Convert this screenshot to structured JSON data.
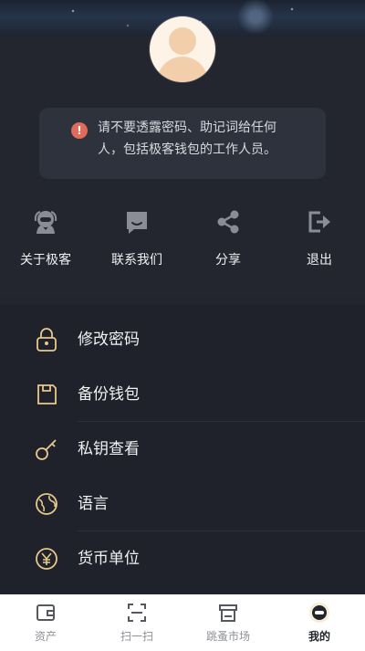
{
  "notice": {
    "text": "请不要透露密码、助记词给任何人，包括极客钱包的工作人员。",
    "icon": "exclamation-circle-icon",
    "icon_color": "#e06b5a"
  },
  "actions": [
    {
      "label": "关于极客",
      "icon": "geek-mascot-icon"
    },
    {
      "label": "联系我们",
      "icon": "chat-bubble-icon"
    },
    {
      "label": "分享",
      "icon": "share-icon"
    },
    {
      "label": "退出",
      "icon": "exit-icon"
    }
  ],
  "menu": [
    {
      "label": "修改密码",
      "icon": "lock-icon"
    },
    {
      "label": "备份钱包",
      "icon": "backup-icon"
    },
    {
      "label": "私钥查看",
      "icon": "key-icon"
    },
    {
      "label": "语言",
      "icon": "globe-icon"
    },
    {
      "label": "货币单位",
      "icon": "currency-yen-icon"
    }
  ],
  "tabs": [
    {
      "label": "资产",
      "icon": "wallet-icon",
      "active": false
    },
    {
      "label": "扫一扫",
      "icon": "scan-icon",
      "active": false
    },
    {
      "label": "跳蚤市场",
      "icon": "market-icon",
      "active": false
    },
    {
      "label": "我的",
      "icon": "profile-avatar-icon",
      "active": true
    }
  ],
  "colors": {
    "background": "#22252e",
    "menu_background": "#1f222a",
    "accent_gold": "#e9c98a",
    "action_icon_gray": "#8a8d95"
  }
}
